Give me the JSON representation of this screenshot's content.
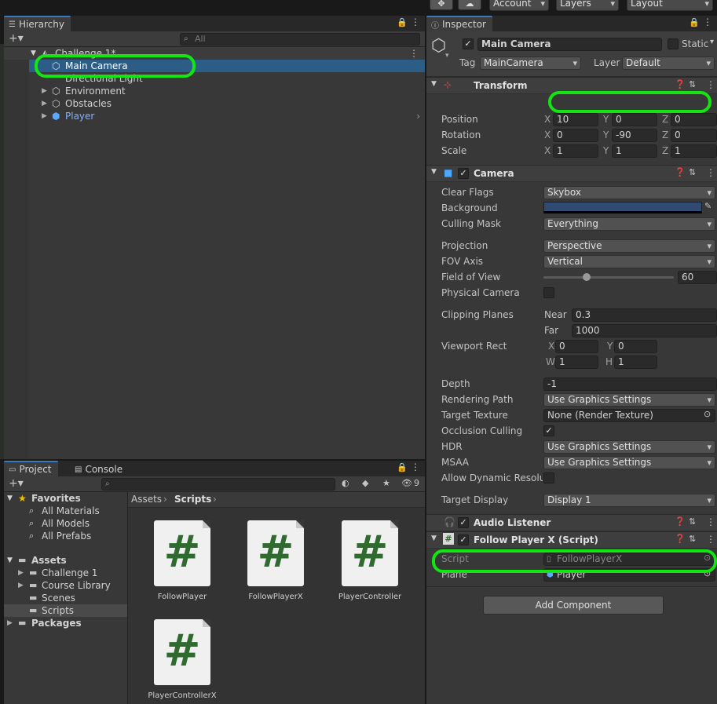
{
  "topbar": {
    "account": "Account",
    "layers": "Layers",
    "layout": "Layout"
  },
  "hierarchy": {
    "tab": "Hierarchy",
    "search_placeholder": "All",
    "scene": "Challenge 1*",
    "items": [
      "Main Camera",
      "Directional Light",
      "Environment",
      "Obstacles",
      "Player"
    ]
  },
  "project": {
    "tabs": [
      "Project",
      "Console"
    ],
    "hidden_count": "9",
    "favorites": "Favorites",
    "favorite_items": [
      "All Materials",
      "All Models",
      "All Prefabs"
    ],
    "assets": "Assets",
    "asset_folders": [
      "Challenge 1",
      "Course Library",
      "Scenes",
      "Scripts"
    ],
    "packages": "Packages",
    "breadcrumb": [
      "Assets",
      "Scripts"
    ],
    "files": [
      "FollowPlayer",
      "FollowPlayerX",
      "PlayerController",
      "PlayerControllerX"
    ],
    "file_glyph": "#"
  },
  "inspector": {
    "tab": "Inspector",
    "object_name": "Main Camera",
    "static_label": "Static",
    "tag_label": "Tag",
    "tag_value": "MainCamera",
    "layer_label": "Layer",
    "layer_value": "Default",
    "transform": {
      "title": "Transform",
      "position_label": "Position",
      "position": [
        "10",
        "0",
        "0"
      ],
      "rotation_label": "Rotation",
      "rotation": [
        "0",
        "-90",
        "0"
      ],
      "scale_label": "Scale",
      "scale": [
        "1",
        "1",
        "1"
      ],
      "axes": [
        "X",
        "Y",
        "Z"
      ]
    },
    "camera": {
      "title": "Camera",
      "clear_flags_label": "Clear Flags",
      "clear_flags": "Skybox",
      "background_label": "Background",
      "background_color": "#304a72",
      "culling_mask_label": "Culling Mask",
      "culling_mask": "Everything",
      "projection_label": "Projection",
      "projection": "Perspective",
      "fov_axis_label": "FOV Axis",
      "fov_axis": "Vertical",
      "fov_label": "Field of View",
      "fov": "60",
      "fov_slider_fraction": 0.33,
      "physical_label": "Physical Camera",
      "clipping_label": "Clipping Planes",
      "near_label": "Near",
      "near": "0.3",
      "far_label": "Far",
      "far": "1000",
      "viewport_label": "Viewport Rect",
      "vp_x_label": "X",
      "vp_x": "0",
      "vp_y_label": "Y",
      "vp_y": "0",
      "vp_w_label": "W",
      "vp_w": "1",
      "vp_h_label": "H",
      "vp_h": "1",
      "depth_label": "Depth",
      "depth": "-1",
      "rendering_path_label": "Rendering Path",
      "rendering_path": "Use Graphics Settings",
      "target_texture_label": "Target Texture",
      "target_texture": "None (Render Texture)",
      "occlusion_label": "Occlusion Culling",
      "hdr_label": "HDR",
      "hdr": "Use Graphics Settings",
      "msaa_label": "MSAA",
      "msaa": "Use Graphics Settings",
      "dynamic_res_label": "Allow Dynamic Resolut",
      "target_display_label": "Target Display",
      "target_display": "Display 1"
    },
    "audio_listener": {
      "title": "Audio Listener"
    },
    "follow_player": {
      "title": "Follow Player X (Script)",
      "script_label": "Script",
      "script": "FollowPlayerX",
      "plane_label": "Plane",
      "plane": "Player"
    },
    "add_component": "Add Component"
  },
  "colors": {
    "selection": "#2c5d87",
    "highlight": "#12e512",
    "player_blue": "#7fb2ff"
  }
}
